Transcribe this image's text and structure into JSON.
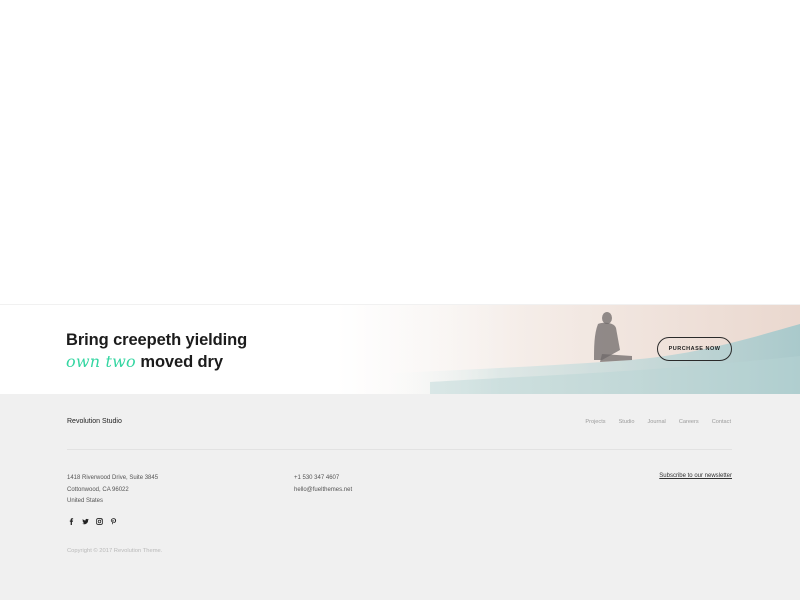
{
  "cta": {
    "heading_line1": "Bring creepeth yielding",
    "heading_accent": "own two",
    "heading_line2_rest": " moved dry",
    "button_label": "PURCHASE NOW"
  },
  "footer": {
    "brand": "Revolution Studio",
    "nav": [
      "Projects",
      "Studio",
      "Journal",
      "Careers",
      "Contact"
    ],
    "address": [
      "1418 Riverwood Drive, Suite 3845",
      "Cottonwood, CA 96022",
      "United States"
    ],
    "phone": "+1 530 347 4607",
    "email": "hello@fuelthemes.net",
    "newsletter": "Subscribe to our newsletter",
    "social_icons": [
      "facebook-icon",
      "twitter-icon",
      "instagram-icon",
      "pinterest-icon"
    ],
    "copyright": "Copyright © 2017 Revolution Theme."
  },
  "colors": {
    "accent": "#35d6a2",
    "footer_bg": "#f0f0f0"
  }
}
